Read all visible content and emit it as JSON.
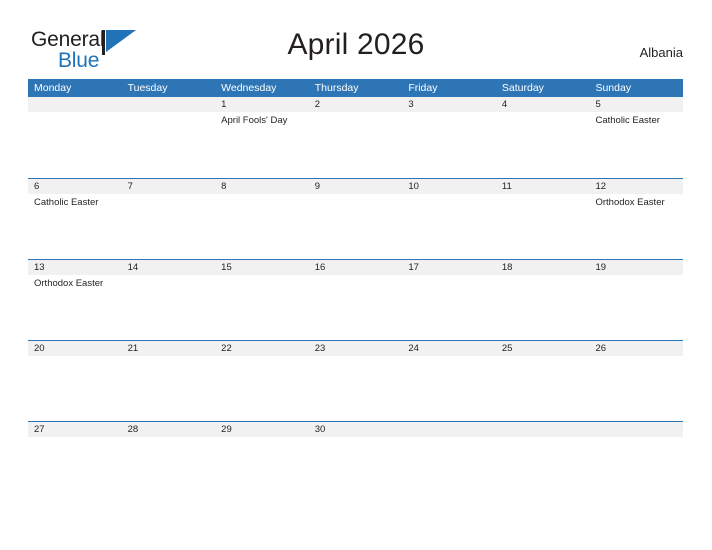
{
  "brand": {
    "name_part1": "General",
    "name_part2": "Blue",
    "flag_icon": "blue-flag-triangle"
  },
  "header": {
    "title": "April 2026",
    "location": "Albania"
  },
  "calendar": {
    "weekday_headers": [
      "Monday",
      "Tuesday",
      "Wednesday",
      "Thursday",
      "Friday",
      "Saturday",
      "Sunday"
    ],
    "colors": {
      "header_blue": "#2e75b6",
      "row_band_gray": "#f1f1f1",
      "brand_blue": "#2173b8",
      "text": "#231f20"
    },
    "weeks": [
      {
        "days": [
          {
            "num": "",
            "events": []
          },
          {
            "num": "",
            "events": []
          },
          {
            "num": "1",
            "events": [
              "April Fools' Day"
            ]
          },
          {
            "num": "2",
            "events": []
          },
          {
            "num": "3",
            "events": []
          },
          {
            "num": "4",
            "events": []
          },
          {
            "num": "5",
            "events": [
              "Catholic Easter"
            ]
          }
        ]
      },
      {
        "days": [
          {
            "num": "6",
            "events": [
              "Catholic Easter"
            ]
          },
          {
            "num": "7",
            "events": []
          },
          {
            "num": "8",
            "events": []
          },
          {
            "num": "9",
            "events": []
          },
          {
            "num": "10",
            "events": []
          },
          {
            "num": "11",
            "events": []
          },
          {
            "num": "12",
            "events": [
              "Orthodox Easter"
            ]
          }
        ]
      },
      {
        "days": [
          {
            "num": "13",
            "events": [
              "Orthodox Easter"
            ]
          },
          {
            "num": "14",
            "events": []
          },
          {
            "num": "15",
            "events": []
          },
          {
            "num": "16",
            "events": []
          },
          {
            "num": "17",
            "events": []
          },
          {
            "num": "18",
            "events": []
          },
          {
            "num": "19",
            "events": []
          }
        ]
      },
      {
        "days": [
          {
            "num": "20",
            "events": []
          },
          {
            "num": "21",
            "events": []
          },
          {
            "num": "22",
            "events": []
          },
          {
            "num": "23",
            "events": []
          },
          {
            "num": "24",
            "events": []
          },
          {
            "num": "25",
            "events": []
          },
          {
            "num": "26",
            "events": []
          }
        ]
      },
      {
        "days": [
          {
            "num": "27",
            "events": []
          },
          {
            "num": "28",
            "events": []
          },
          {
            "num": "29",
            "events": []
          },
          {
            "num": "30",
            "events": []
          },
          {
            "num": "",
            "events": []
          },
          {
            "num": "",
            "events": []
          },
          {
            "num": "",
            "events": []
          }
        ]
      }
    ]
  }
}
